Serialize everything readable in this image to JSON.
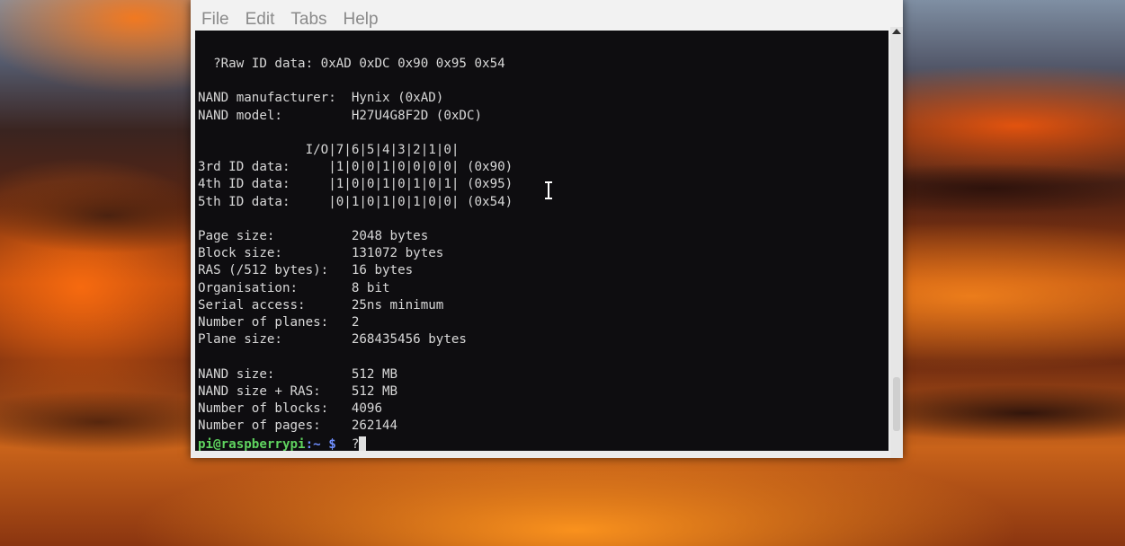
{
  "menu": {
    "file": "File",
    "edit": "Edit",
    "tabs": "Tabs",
    "help": "Help"
  },
  "terminal": {
    "lines": [
      "  ?Raw ID data: 0xAD 0xDC 0x90 0x95 0x54",
      "",
      "NAND manufacturer:  Hynix (0xAD)",
      "NAND model:         H27U4G8F2D (0xDC)",
      "",
      "              I/O|7|6|5|4|3|2|1|0|",
      "3rd ID data:     |1|0|0|1|0|0|0|0| (0x90)",
      "4th ID data:     |1|0|0|1|0|1|0|1| (0x95)",
      "5th ID data:     |0|1|0|1|0|1|0|0| (0x54)",
      "",
      "Page size:          2048 bytes",
      "Block size:         131072 bytes",
      "RAS (/512 bytes):   16 bytes",
      "Organisation:       8 bit",
      "Serial access:      25ns minimum",
      "Number of planes:   2",
      "Plane size:         268435456 bytes",
      "",
      "NAND size:          512 MB",
      "NAND size + RAS:    512 MB",
      "Number of blocks:   4096",
      "Number of pages:    262144"
    ],
    "prompt": {
      "user_host": "pi@raspberrypi",
      "path": ":~ $",
      "input": "  ?"
    }
  }
}
